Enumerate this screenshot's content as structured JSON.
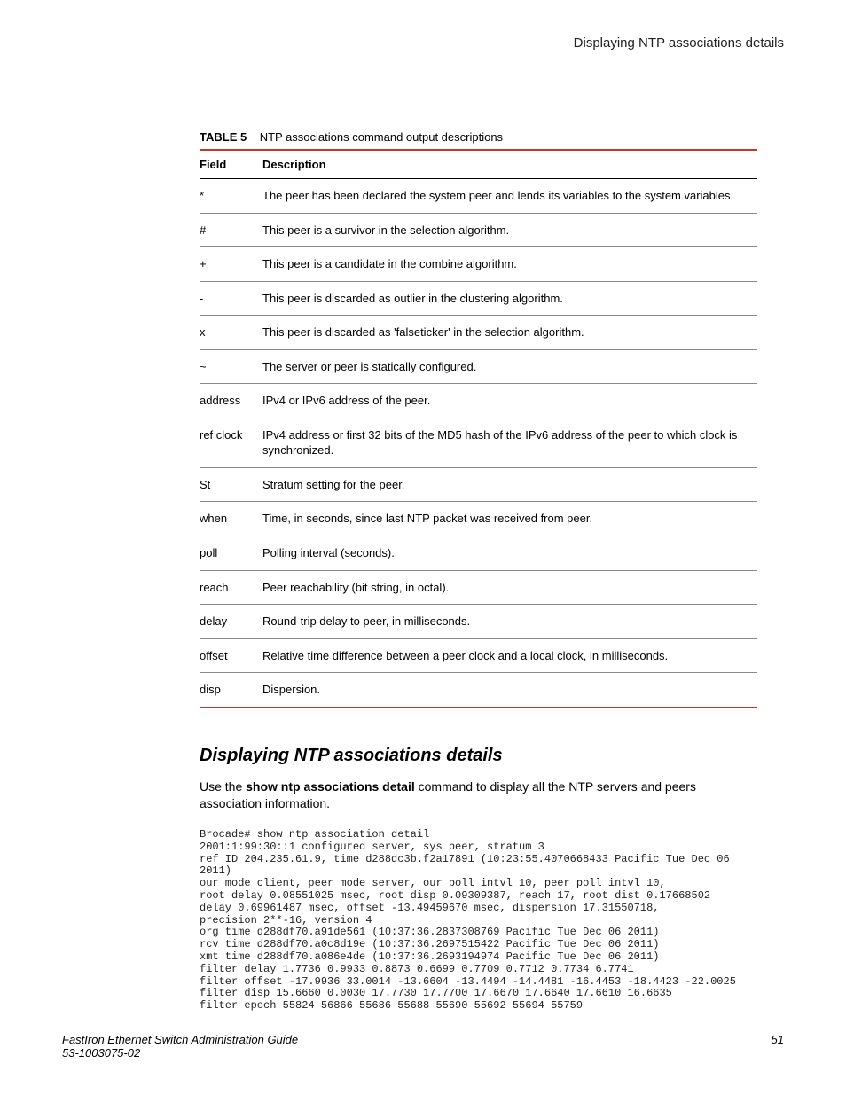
{
  "header": {
    "title": "Displaying NTP associations details"
  },
  "table": {
    "caption_label": "TABLE 5",
    "caption_text": "NTP associations command output descriptions",
    "head_field": "Field",
    "head_desc": "Description",
    "rows": [
      {
        "field": "*",
        "desc": "The peer has been declared the system peer and lends its variables to the system variables."
      },
      {
        "field": "#",
        "desc": "This peer is a survivor in the selection algorithm."
      },
      {
        "field": "+",
        "desc": "This peer is a candidate in the combine algorithm."
      },
      {
        "field": "-",
        "desc": "This peer is discarded as outlier in the clustering algorithm."
      },
      {
        "field": "x",
        "desc": "This peer is discarded as 'falseticker' in the selection algorithm."
      },
      {
        "field": "~",
        "desc": "The server or peer is statically configured."
      },
      {
        "field": "address",
        "desc": "IPv4 or IPv6 address of the peer."
      },
      {
        "field": "ref clock",
        "desc": "IPv4 address or first 32 bits of the MD5 hash of the IPv6 address of the peer to which clock is synchronized."
      },
      {
        "field": "St",
        "desc": "Stratum setting for the peer."
      },
      {
        "field": "when",
        "desc": "Time, in seconds, since last NTP packet was received from peer."
      },
      {
        "field": "poll",
        "desc": "Polling interval (seconds)."
      },
      {
        "field": "reach",
        "desc": "Peer reachability (bit string, in octal)."
      },
      {
        "field": "delay",
        "desc": "Round-trip delay to peer, in milliseconds."
      },
      {
        "field": "offset",
        "desc": "Relative time difference between a peer clock and a local clock, in milliseconds."
      },
      {
        "field": "disp",
        "desc": "Dispersion."
      }
    ]
  },
  "section": {
    "heading": "Displaying NTP associations details",
    "intro_pre": "Use the ",
    "intro_bold": "show ntp associations detail",
    "intro_post": " command to display all the NTP servers and peers association information."
  },
  "code": "Brocade# show ntp association detail\n2001:1:99:30::1 configured server, sys peer, stratum 3\nref ID 204.235.61.9, time d288dc3b.f2a17891 (10:23:55.4070668433 Pacific Tue Dec 06\n2011)\nour mode client, peer mode server, our poll intvl 10, peer poll intvl 10,\nroot delay 0.08551025 msec, root disp 0.09309387, reach 17, root dist 0.17668502\ndelay 0.69961487 msec, offset -13.49459670 msec, dispersion 17.31550718,\nprecision 2**-16, version 4\norg time d288df70.a91de561 (10:37:36.2837308769 Pacific Tue Dec 06 2011)\nrcv time d288df70.a0c8d19e (10:37:36.2697515422 Pacific Tue Dec 06 2011)\nxmt time d288df70.a086e4de (10:37:36.2693194974 Pacific Tue Dec 06 2011)\nfilter delay 1.7736 0.9933 0.8873 0.6699 0.7709 0.7712 0.7734 6.7741\nfilter offset -17.9936 33.0014 -13.6604 -13.4494 -14.4481 -16.4453 -18.4423 -22.0025\nfilter disp 15.6660 0.0030 17.7730 17.7700 17.6670 17.6640 17.6610 16.6635\nfilter epoch 55824 56866 55686 55688 55690 55692 55694 55759",
  "footer": {
    "guide": "FastIron Ethernet Switch Administration Guide",
    "docnum": "53-1003075-02",
    "page": "51"
  }
}
